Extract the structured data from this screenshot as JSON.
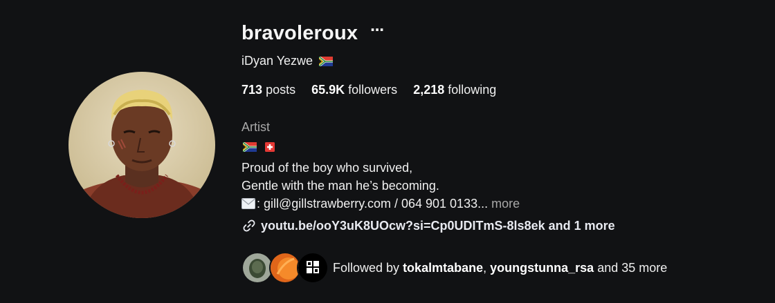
{
  "profile": {
    "username": "bravoleroux",
    "more_options_icon": "ellipsis-icon",
    "full_name": "iDyan Yezwe",
    "stats": {
      "posts_count": "713",
      "posts_label": "posts",
      "followers_count": "65.9K",
      "followers_label": "followers",
      "following_count": "2,218",
      "following_label": "following"
    },
    "category": "Artist",
    "bio": {
      "line1": "Proud of the boy who survived,",
      "line2": "Gentle with the man he’s becoming.",
      "line3": ": gill@gillstrawberry.com / 064 901 0133...",
      "more": "more"
    },
    "link": {
      "icon": "link-icon",
      "text": "youtu.be/ooY3uK8UOcw?si=Cp0UDITmS-8ls8ek and 1 more"
    },
    "followed_by": {
      "prefix": "Followed by",
      "user1": "tokalmtabane",
      "separator": ",",
      "user2": "youngstunna_rsa",
      "suffix": "and 35 more"
    }
  },
  "colors": {
    "background": "#111214",
    "primary_text": "#f5f5f5",
    "secondary_text": "#a8a8a8"
  }
}
